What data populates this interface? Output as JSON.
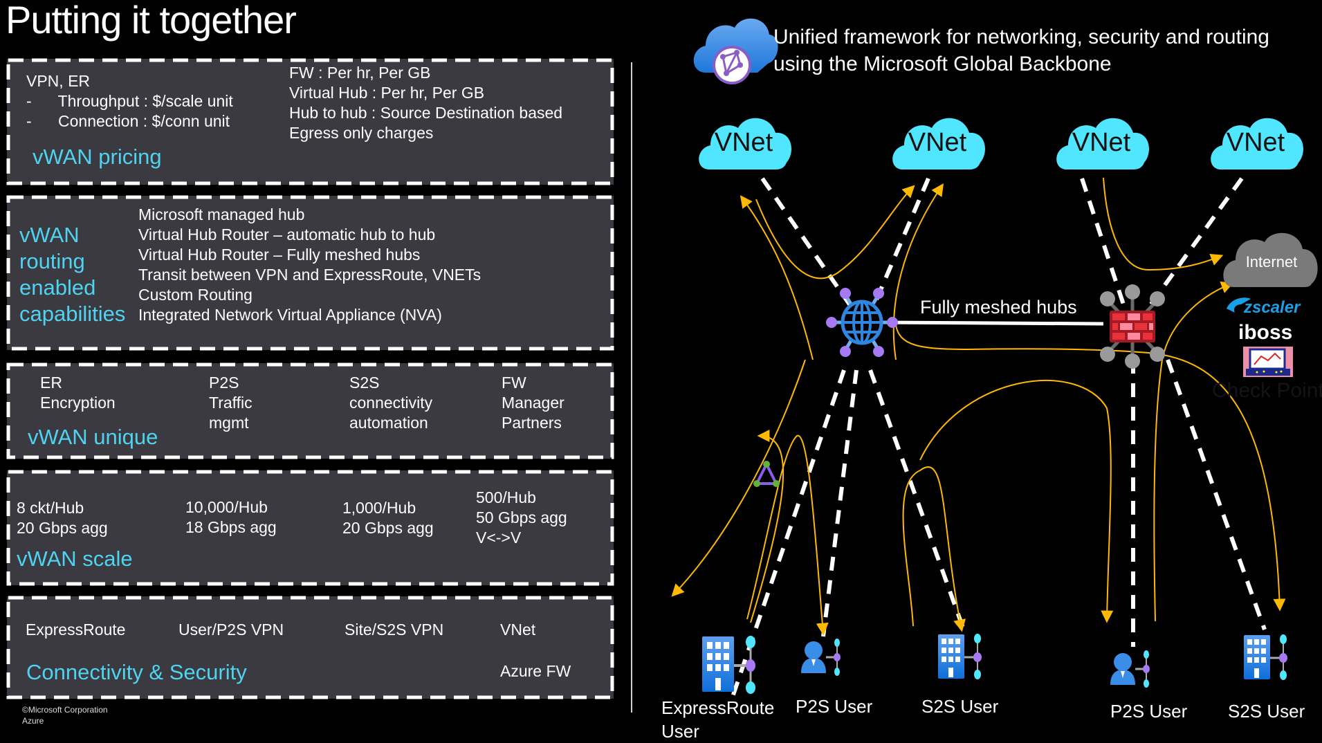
{
  "slide": {
    "title": "Putting it together",
    "copyright": "©Microsoft Corporation",
    "copyright_sub": "Azure"
  },
  "pricing": {
    "heading": "vWAN pricing",
    "left": [
      "VPN, ER",
      "-      Throughput : $/scale unit",
      "-      Connection : $/conn unit"
    ],
    "right": [
      "FW : Per hr, Per GB",
      "Virtual Hub : Per hr, Per GB",
      "Hub to hub : Source Destination based",
      "Egress only charges"
    ]
  },
  "routing": {
    "heading": [
      "vWAN",
      "routing",
      "enabled",
      "capabilities"
    ],
    "items": [
      "Microsoft managed hub",
      "Virtual Hub Router – automatic hub to hub",
      "Virtual Hub Router – Fully meshed hubs",
      "Transit between VPN and ExpressRoute, VNETs",
      "Custom Routing",
      "Integrated Network Virtual Appliance (NVA)"
    ]
  },
  "unique": {
    "heading": "vWAN unique",
    "columns": [
      [
        "ER",
        "Encryption"
      ],
      [
        "P2S",
        "Traffic",
        "mgmt"
      ],
      [
        "S2S",
        "connectivity",
        "automation"
      ],
      [
        "FW",
        "Manager",
        "Partners"
      ]
    ]
  },
  "scale": {
    "heading": "vWAN scale",
    "columns": [
      [
        "8 ckt/Hub",
        "20 Gbps agg"
      ],
      [
        "10,000/Hub",
        "18 Gbps agg"
      ],
      [
        "1,000/Hub",
        "20 Gbps agg"
      ],
      [
        "500/Hub",
        "50 Gbps agg",
        "V<->V"
      ]
    ]
  },
  "connectivity": {
    "heading": "Connectivity & Security",
    "items": [
      "ExpressRoute",
      "User/P2S VPN",
      "Site/S2S VPN",
      "VNet"
    ],
    "extra": "Azure FW"
  },
  "diagram": {
    "header_line1": "Unified framework for networking, security and routing",
    "header_line2": "using the Microsoft Global Backbone",
    "vnet_label": "VNet",
    "hub_link_label": "Fully meshed hubs",
    "internet_label": "Internet",
    "partners": [
      "zscaler",
      "iboss",
      "Check Point"
    ],
    "endpoints": [
      {
        "label": "ExpressRoute",
        "label2": "User",
        "icon": "building-icon"
      },
      {
        "label": "P2S User",
        "icon": "user-icon"
      },
      {
        "label": "S2S User",
        "icon": "building-icon"
      },
      {
        "label": "P2S User",
        "icon": "user-icon"
      },
      {
        "label": "S2S User",
        "icon": "building-icon"
      }
    ],
    "colors": {
      "accent_text": "#4fd3f0",
      "vnet_cloud": "#50e6ff",
      "flow_arrow": "#ffb900",
      "panel_bg": "#3b3a40",
      "internet_cloud": "#7a7a7a",
      "firewall": "#e02d36",
      "hub_globe": "#2f86e0",
      "node_purple": "#a67af4"
    }
  }
}
